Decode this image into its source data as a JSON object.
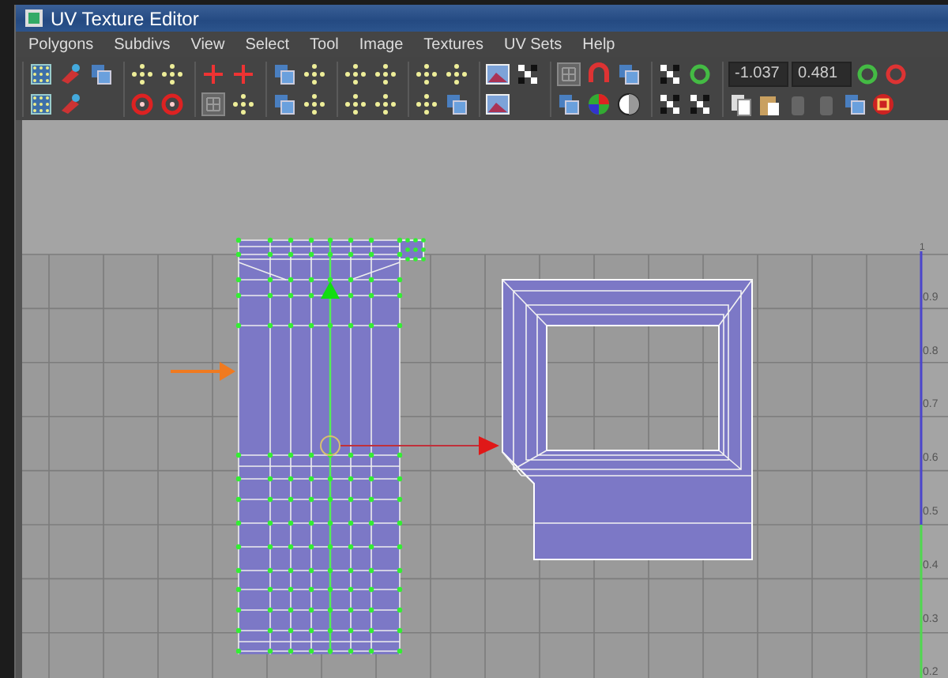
{
  "window": {
    "title": "UV Texture Editor"
  },
  "menu": [
    {
      "label": "Polygons"
    },
    {
      "label": "Subdivs"
    },
    {
      "label": "View"
    },
    {
      "label": "Select"
    },
    {
      "label": "Tool"
    },
    {
      "label": "Image"
    },
    {
      "label": "Textures"
    },
    {
      "label": "UV Sets"
    },
    {
      "label": "Help"
    }
  ],
  "uv_fields": [
    {
      "value": "-1.037"
    },
    {
      "value": "0.481"
    }
  ],
  "v_axis_labels": [
    "1",
    "0.9",
    "0.8",
    "0.7",
    "0.6",
    "0.5",
    "0.4",
    "0.3",
    "0.2"
  ]
}
